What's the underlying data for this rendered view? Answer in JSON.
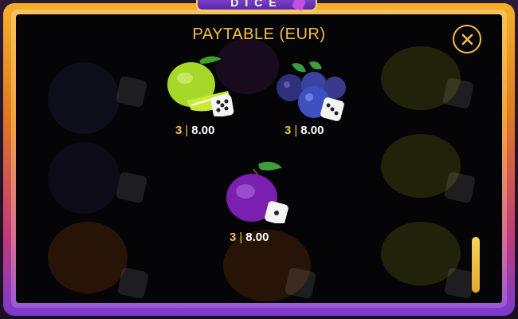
{
  "logo": {
    "text": "DICE"
  },
  "paytable": {
    "title": "PAYTABLE (EUR)",
    "symbols": [
      {
        "name": "lime",
        "count": "3",
        "separator": "|",
        "payout": "8.00"
      },
      {
        "name": "blueberries",
        "count": "3",
        "separator": "|",
        "payout": "8.00"
      },
      {
        "name": "plum",
        "count": "3",
        "separator": "|",
        "payout": "8.00"
      }
    ]
  },
  "colors": {
    "accent": "#f3c245",
    "panel_bg": "#050406",
    "frame_top": "#f4b02a",
    "frame_bottom": "#7a3bd0"
  },
  "icons": {
    "close": "close-icon",
    "die": "dice-icon"
  }
}
